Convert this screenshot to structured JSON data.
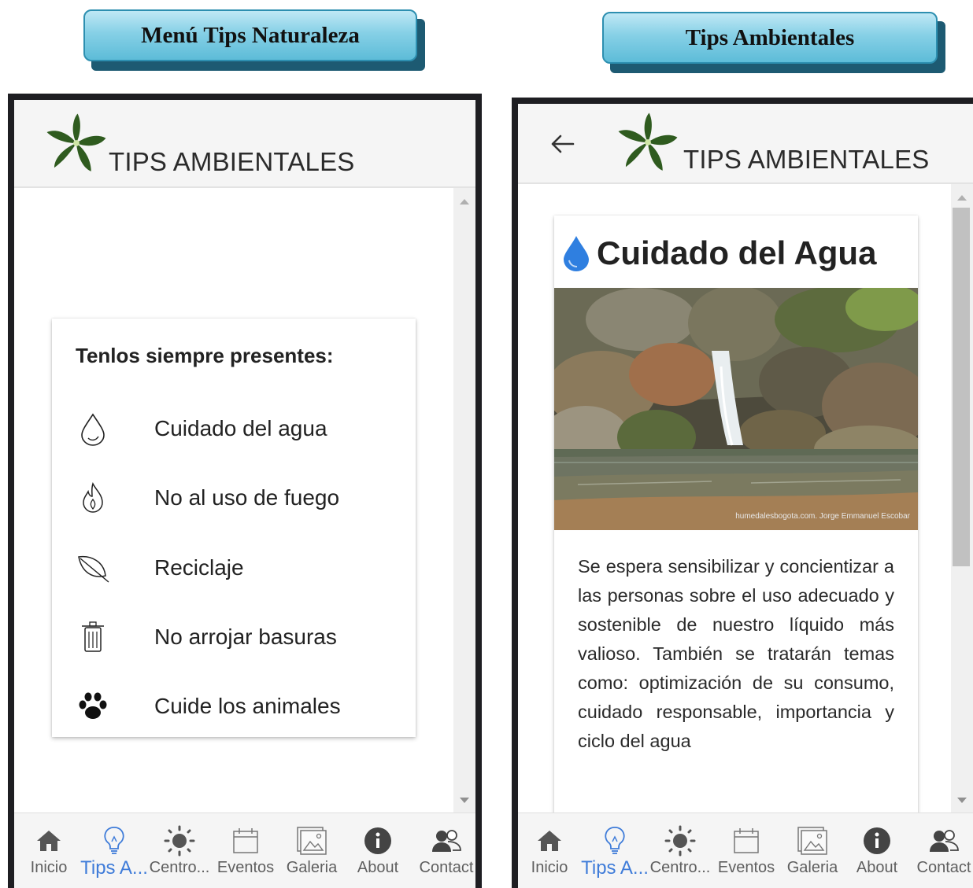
{
  "headers": {
    "left": "Menú Tips Naturaleza",
    "right": "Tips Ambientales"
  },
  "appbar": {
    "title": "TIPS AMBIENTALES",
    "logo_icon": "leaf-star-logo",
    "back_icon": "arrow-left-icon"
  },
  "left_screen": {
    "card_title": "Tenlos siempre presentes:",
    "tips": [
      {
        "label": "Cuidado del agua",
        "icon": "water-drop-icon"
      },
      {
        "label": "No al uso de fuego",
        "icon": "flame-icon"
      },
      {
        "label": "Reciclaje",
        "icon": "leaf-icon"
      },
      {
        "label": "No arrojar basuras",
        "icon": "trash-icon"
      },
      {
        "label": "Cuide los animales",
        "icon": "paw-icon"
      }
    ]
  },
  "right_screen": {
    "title": "Cuidado del Agua",
    "title_icon": "water-drop-filled-icon",
    "photo_credit": "humedalesbogota.com. Jorge Emmanuel Escobar",
    "body": "Se espera sensibilizar y concientizar a las personas sobre el uso adecuado y sostenible de nuestro líquido más valioso. También se tratarán temas como: optimización de su consumo, cuidado responsable, importancia y ciclo del agua"
  },
  "bottom_nav": {
    "items": [
      {
        "label": "Inicio",
        "icon": "home-icon"
      },
      {
        "label": "Tips A...",
        "icon": "lightbulb-icon",
        "active": true
      },
      {
        "label": "Centro...",
        "icon": "sun-icon"
      },
      {
        "label": "Eventos",
        "icon": "calendar-icon"
      },
      {
        "label": "Galeria",
        "icon": "image-icon"
      },
      {
        "label": "About",
        "icon": "info-icon"
      },
      {
        "label": "Contact",
        "icon": "contacts-icon"
      }
    ]
  },
  "colors": {
    "accent": "#3f7cd9",
    "label_gradient_top": "#bfe8f5",
    "label_gradient_bottom": "#5dbcd8",
    "logo_green": "#2f5b1f"
  }
}
